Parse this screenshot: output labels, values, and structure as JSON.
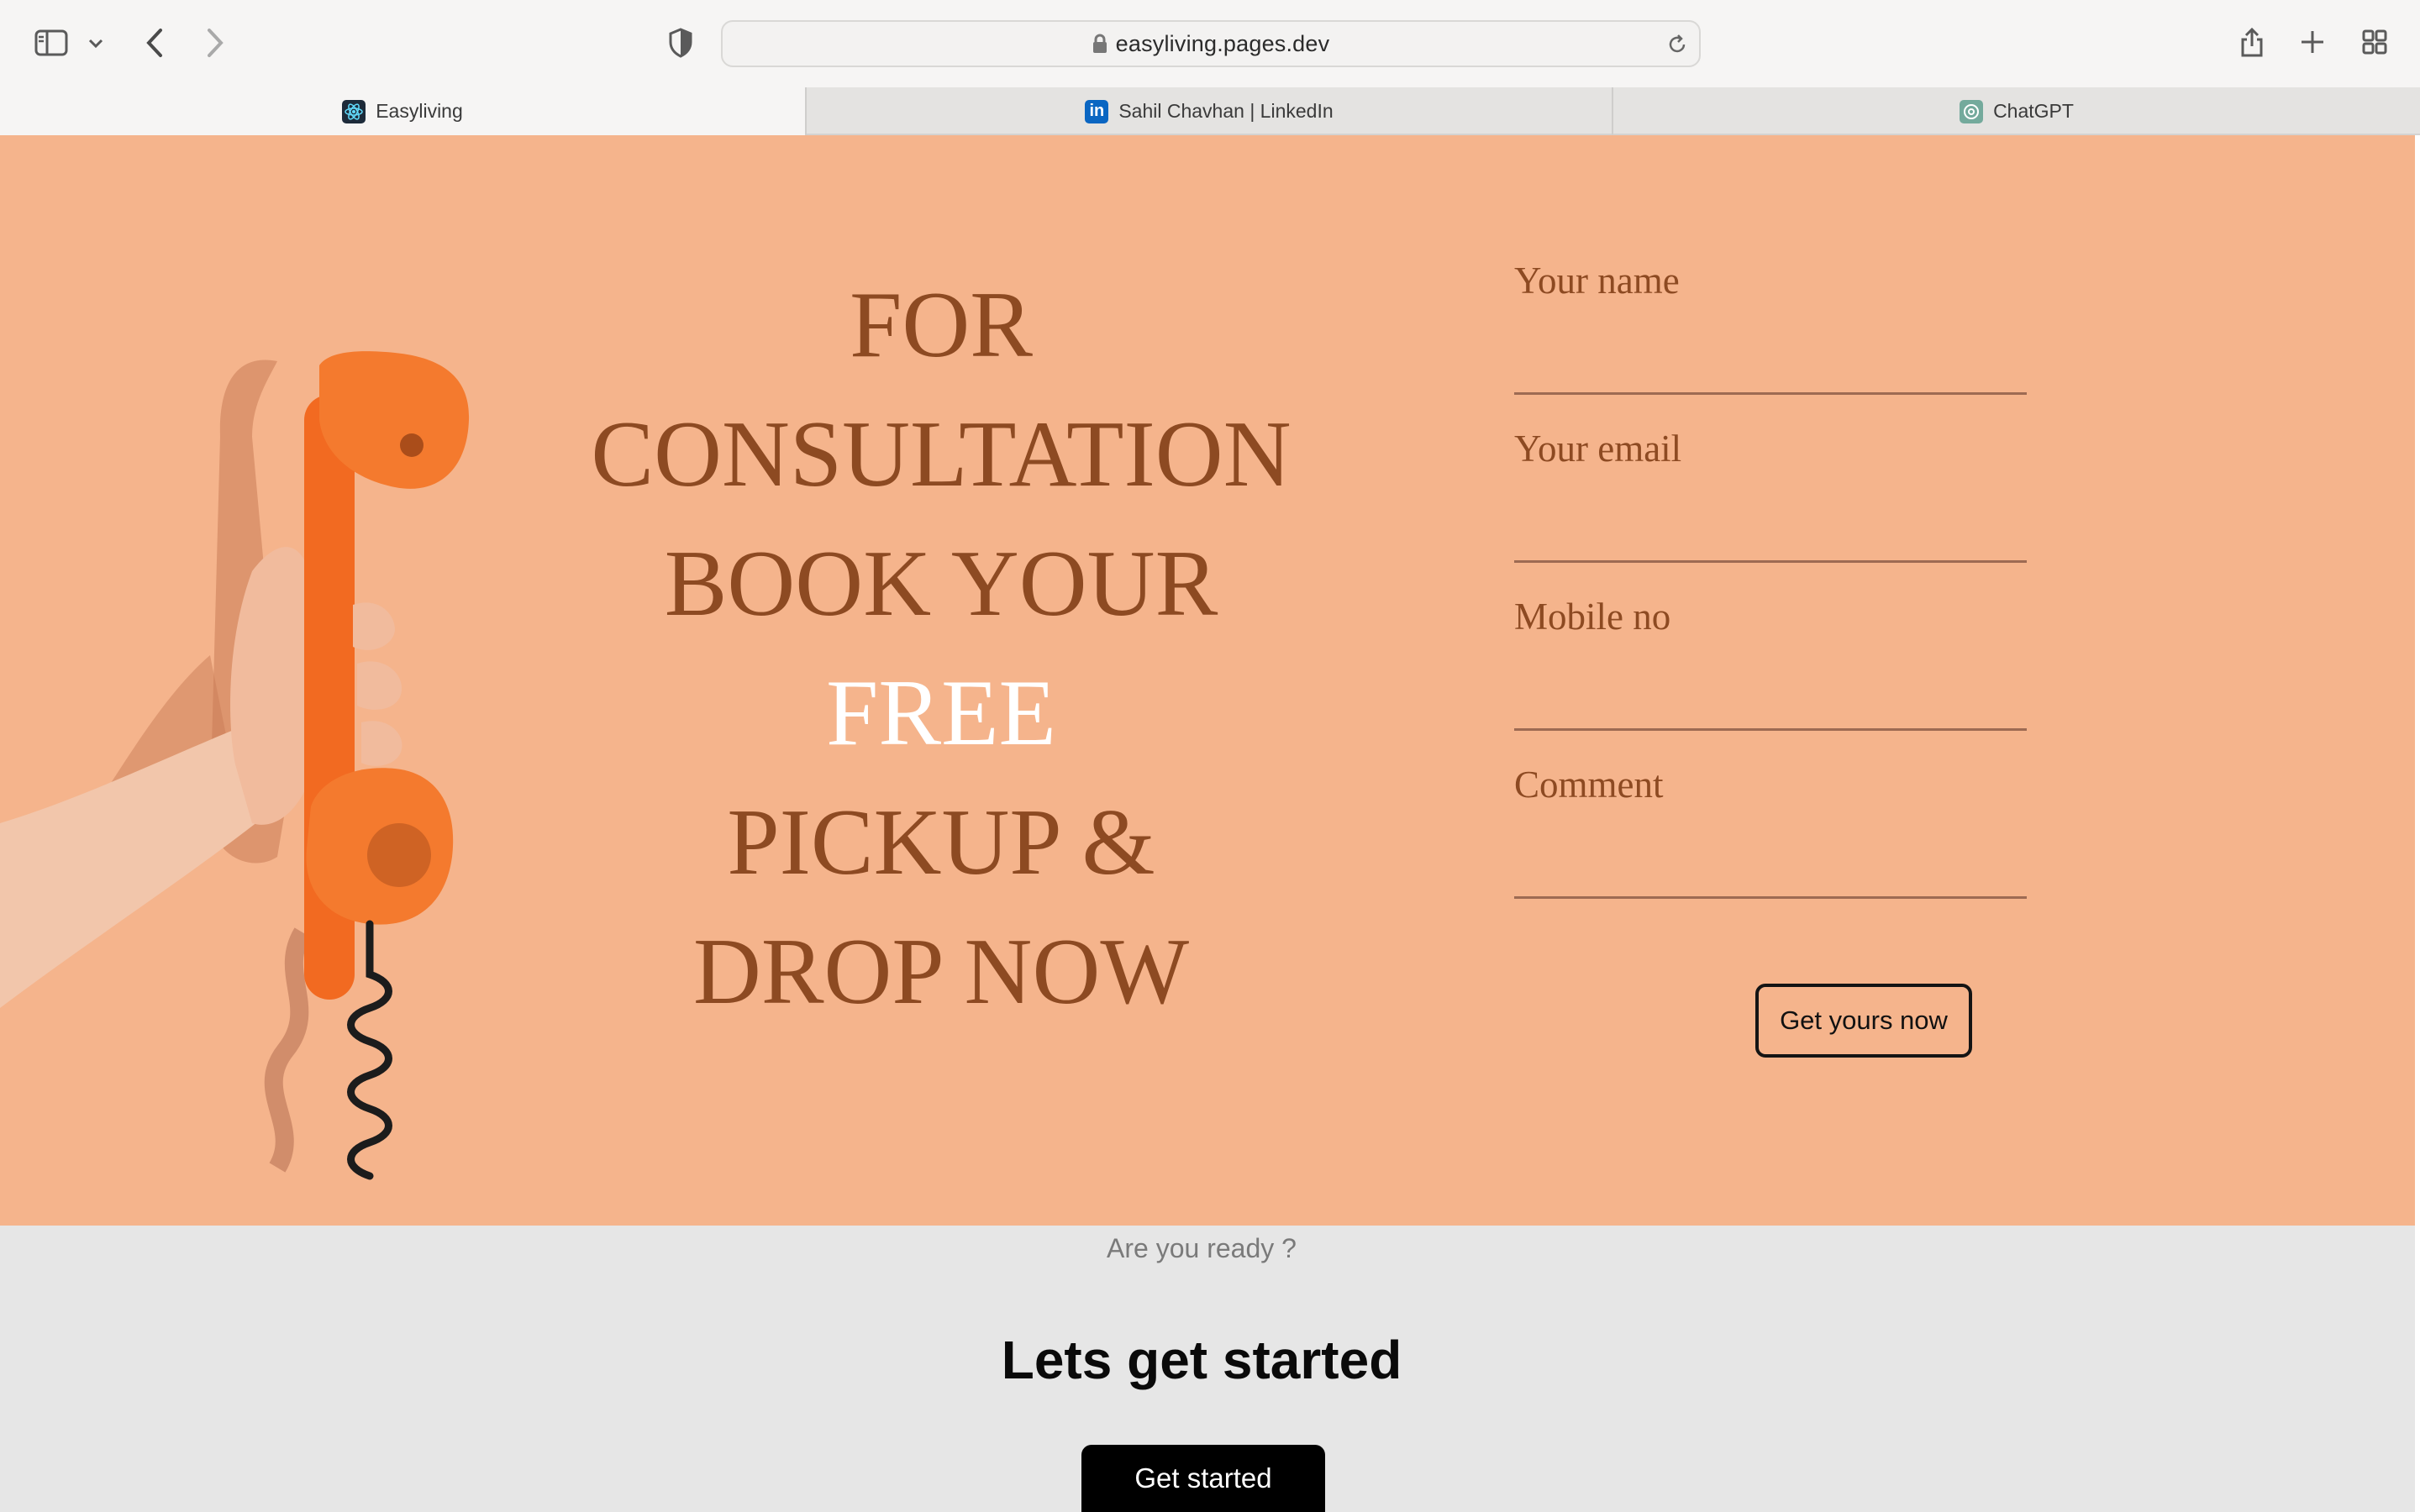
{
  "browser": {
    "url": "easyliving.pages.dev",
    "tabs": [
      {
        "label": "Easyliving",
        "active": true,
        "favicon": "react-icon"
      },
      {
        "label": "Sahil Chavhan | LinkedIn",
        "active": false,
        "favicon": "linkedin-icon"
      },
      {
        "label": "ChatGPT",
        "active": false,
        "favicon": "chatgpt-icon"
      }
    ]
  },
  "hero": {
    "headline": {
      "line1": "FOR",
      "line2": "CONSULTATION",
      "line3": "BOOK YOUR",
      "line4": "FREE",
      "line5": "PICKUP &",
      "line6": "DROP NOW"
    },
    "form": {
      "name_label": "Your name",
      "email_label": "Your email",
      "mobile_label": "Mobile no",
      "comment_label": "Comment",
      "submit_label": "Get yours now"
    }
  },
  "cta": {
    "subtitle": "Are you ready ?",
    "title": "Lets get started",
    "button_label": "Get started"
  },
  "colors": {
    "hero_bg": "#f5b48c",
    "headline": "#8d4a22",
    "highlight": "#ffffff",
    "cta_bg": "#e6e6e6",
    "button_dark": "#000000"
  }
}
